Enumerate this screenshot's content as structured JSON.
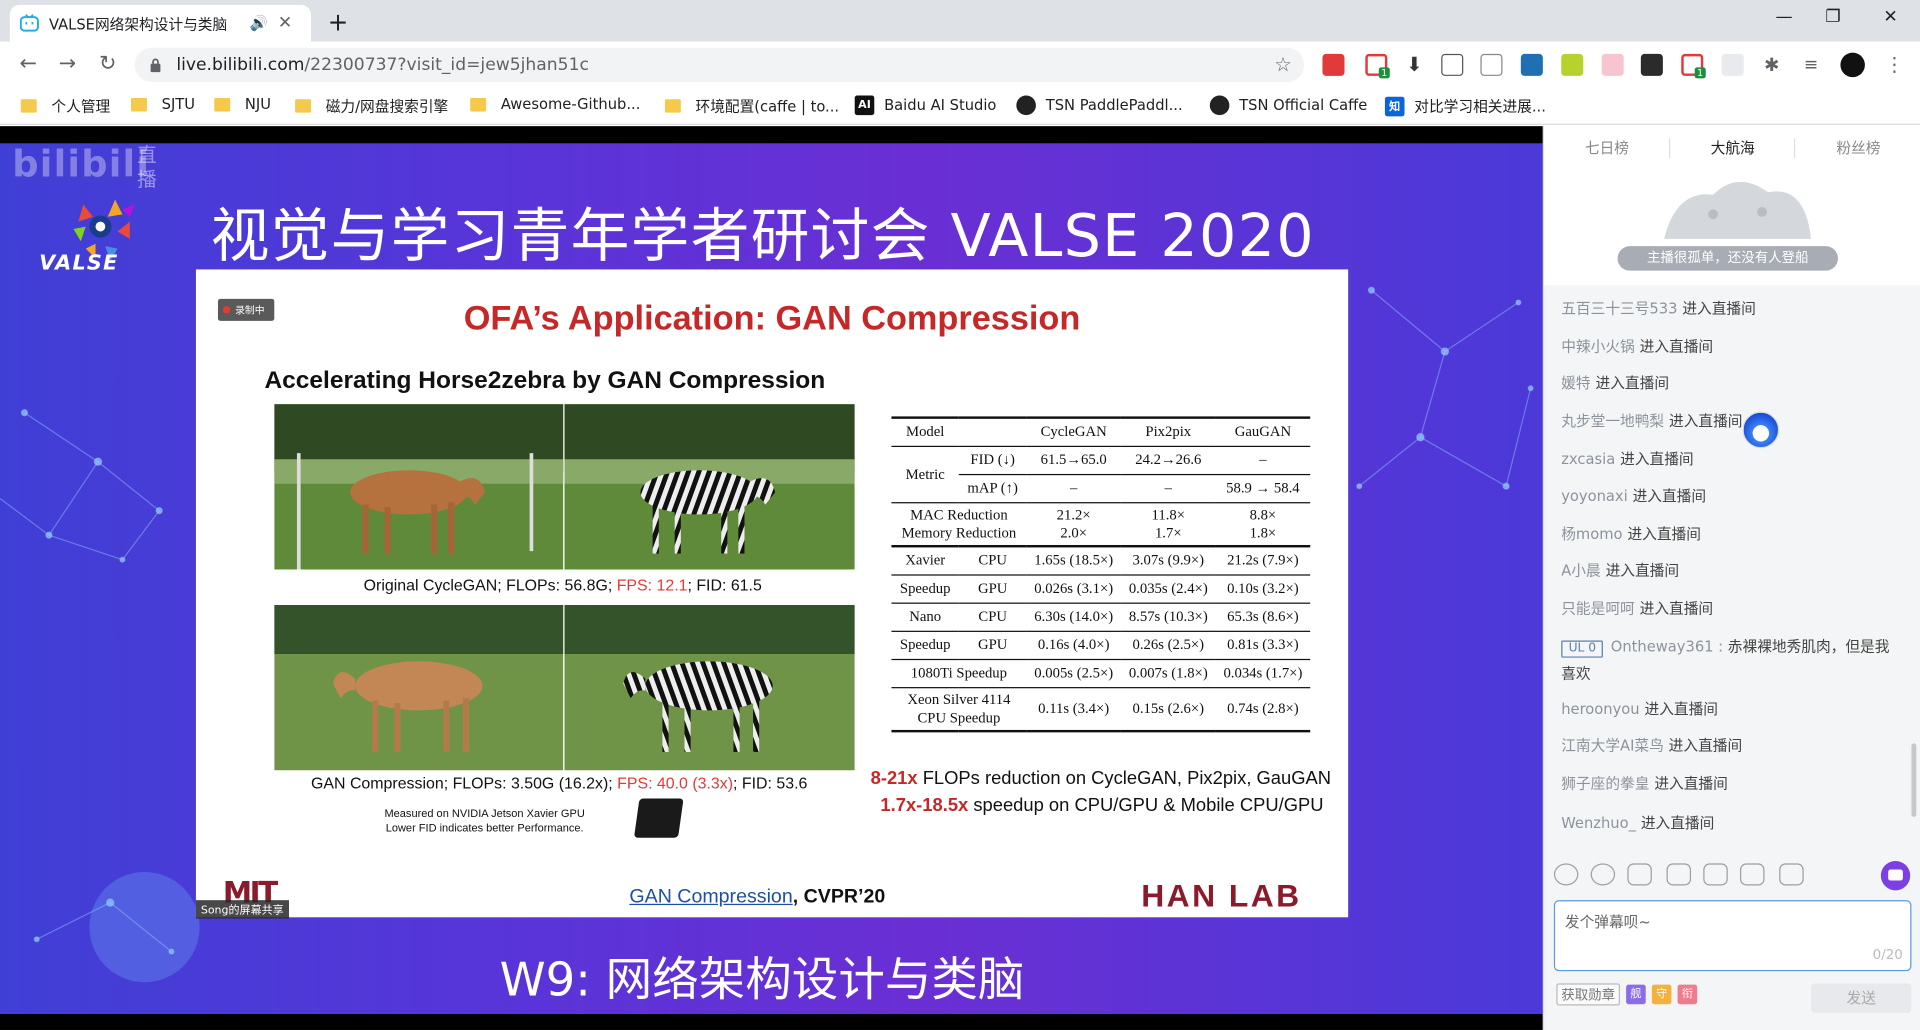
{
  "browser": {
    "tab_title": "VALSE网络架构设计与类脑",
    "tab_audio": "🔊",
    "url_main": "live.bilibili.com",
    "url_path": "/22300737?visit_id=jew5jhan51c",
    "ext_badge_1": "1",
    "ext_badge_2": "1"
  },
  "bookmarks": [
    {
      "label": "个人管理"
    },
    {
      "label": "SJTU"
    },
    {
      "label": "NJU"
    },
    {
      "label": "磁力/网盘搜索引擎"
    },
    {
      "label": "Awesome-Github..."
    },
    {
      "label": "环境配置(caffe | to..."
    },
    {
      "label": "Baidu AI Studio",
      "icon_text": "AI"
    },
    {
      "label": "TSN PaddlePaddl..."
    },
    {
      "label": "TSN Official Caffe"
    },
    {
      "label": "对比学习相关进展...",
      "icon_text": "知"
    }
  ],
  "stream": {
    "watermark": "bilibili",
    "watermark_live": "直播",
    "logo_text": "VALSE",
    "conference_title": "视觉与学习青年学者研讨会 VALSE 2020",
    "session_title": "W9: 网络架构设计与类脑",
    "share_label": "Song的屏幕共享"
  },
  "slide": {
    "rec_badge": "录制中",
    "title": "OFA’s Application: GAN Compression",
    "subtitle": "Accelerating Horse2zebra by GAN Compression",
    "caption1_prefix": "Original CycleGAN; FLOPs: 56.8G; ",
    "caption1_fps": "FPS: 12.1",
    "caption1_suffix": "; FID: 61.5",
    "caption2_prefix": "GAN Compression; FLOPs: 3.50G (16.2x); ",
    "caption2_fps": "FPS: 40.0 (3.3x)",
    "caption2_suffix": "; FID: 53.6",
    "note_line1": "Measured on NVIDIA Jetson Xavier GPU",
    "note_line2": "Lower FID indicates better Performance.",
    "result1_hl": "8-21x",
    "result1_text": " FLOPs reduction on CycleGAN, Pix2pix, GauGAN",
    "result2_hl": "1.7x-18.5x",
    "result2_text": " speedup on CPU/GPU & Mobile CPU/GPU",
    "cite_link": "GAN Compression",
    "cite_venue": ", CVPR’20",
    "logo_left": "MIT",
    "logo_right": "HAN LAB",
    "table": {
      "header": [
        "Model",
        "CycleGAN",
        "Pix2pix",
        "GauGAN"
      ],
      "metric_label": "Metric",
      "fid_label": "FID (↓)",
      "fid": [
        "61.5→65.0",
        "24.2→26.6",
        "–"
      ],
      "map_label": "mAP (↑)",
      "map": [
        "–",
        "–",
        "58.9 → 58.4"
      ],
      "mac_label": "MAC Reduction",
      "mem_label": "Memory Reduction",
      "mac": [
        "21.2×",
        "11.8×",
        "8.8×"
      ],
      "mem": [
        "2.0×",
        "1.7×",
        "1.8×"
      ],
      "xavier_label": "Xavier",
      "speedup_label": "Speedup",
      "nano_label": "Nano",
      "cpu_label": "CPU",
      "gpu_label": "GPU",
      "xavier_cpu": [
        "1.65s (18.5×)",
        "3.07s (9.9×)",
        "21.2s (7.9×)"
      ],
      "xavier_gpu": [
        "0.026s (3.1×)",
        "0.035s (2.4×)",
        "0.10s (3.2×)"
      ],
      "nano_cpu": [
        "6.30s (14.0×)",
        "8.57s (10.3×)",
        "65.3s (8.6×)"
      ],
      "nano_gpu": [
        "0.16s (4.0×)",
        "0.26s (2.5×)",
        "0.81s (3.3×)"
      ],
      "ti_label": "1080Ti Speedup",
      "ti": [
        "0.005s (2.5×)",
        "0.007s (1.8×)",
        "0.034s (1.7×)"
      ],
      "xeon_label1": "Xeon Silver 4114",
      "xeon_label2": "CPU Speedup",
      "xeon": [
        "0.11s (3.4×)",
        "0.15s (2.6×)",
        "0.74s (2.8×)"
      ]
    }
  },
  "sidebar": {
    "rank_tabs": [
      "七日榜",
      "大航海",
      "粉丝榜"
    ],
    "empty_text": "主播很孤单，还没有人登船",
    "enter_text": "进入直播间",
    "messages": [
      {
        "user": "五百三十三号533",
        "enter": true
      },
      {
        "user": "中辣小火锅",
        "enter": true
      },
      {
        "user": "媛特",
        "enter": true
      },
      {
        "user": "丸步堂一地鸭梨",
        "enter": true
      },
      {
        "user": "zxcasia",
        "enter": true
      },
      {
        "user": "yoyonaxi",
        "enter": true
      },
      {
        "user": "杨momo",
        "enter": true
      },
      {
        "user": "A小晨",
        "enter": true
      },
      {
        "user": "只能是呵呵",
        "enter": true
      },
      {
        "user": "Ontheway361 : ",
        "medal": "UL 0",
        "text": "赤裸裸地秀肌肉，但是我",
        "text2": "喜欢"
      },
      {
        "user": "heroonyou",
        "enter": true
      },
      {
        "user": "江南大学AI菜鸟",
        "enter": true
      },
      {
        "user": "狮子座的拳皇",
        "enter": true
      },
      {
        "user": "Wenzhuo_",
        "enter": true
      }
    ],
    "input_placeholder": "发个弹幕呗~",
    "input_count": "0/20",
    "fetch_medal": "获取勋章",
    "badges": [
      "舰",
      "守",
      "衔"
    ],
    "send": "发送"
  }
}
